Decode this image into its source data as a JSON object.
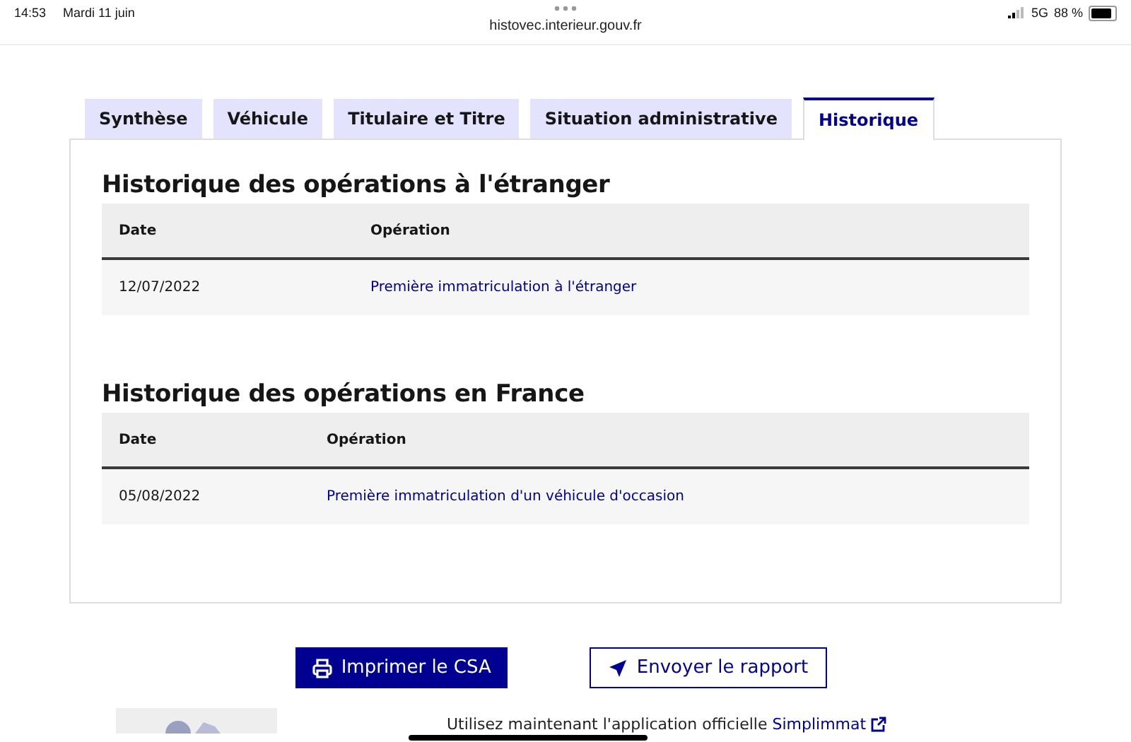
{
  "status_bar": {
    "time": "14:53",
    "date": "Mardi 11 juin",
    "network": "5G",
    "battery": "88 %"
  },
  "address_bar": {
    "url": "histovec.interieur.gouv.fr"
  },
  "tabs": [
    {
      "label": "Synthèse",
      "selected": false
    },
    {
      "label": "Véhicule",
      "selected": false
    },
    {
      "label": "Titulaire et Titre",
      "selected": false
    },
    {
      "label": "Situation administrative",
      "selected": false
    },
    {
      "label": "Historique",
      "selected": true
    }
  ],
  "sections": [
    {
      "title": "Historique des opérations à l'étranger",
      "columns": [
        "Date",
        "Opération"
      ],
      "rows": [
        [
          "12/07/2022",
          "Première immatriculation à l'étranger"
        ]
      ]
    },
    {
      "title": "Historique des opérations en France",
      "columns": [
        "Date",
        "Opération"
      ],
      "rows": [
        [
          "05/08/2022",
          "Première immatriculation d'un véhicule d'occasion"
        ]
      ]
    }
  ],
  "buttons": [
    {
      "label": "Imprimer le CSA",
      "kind": "primary"
    },
    {
      "label": "Envoyer le rapport",
      "kind": "secondary"
    }
  ],
  "footer": {
    "text": "Utilisez maintenant l'application officielle",
    "link": "Simplimmat"
  }
}
